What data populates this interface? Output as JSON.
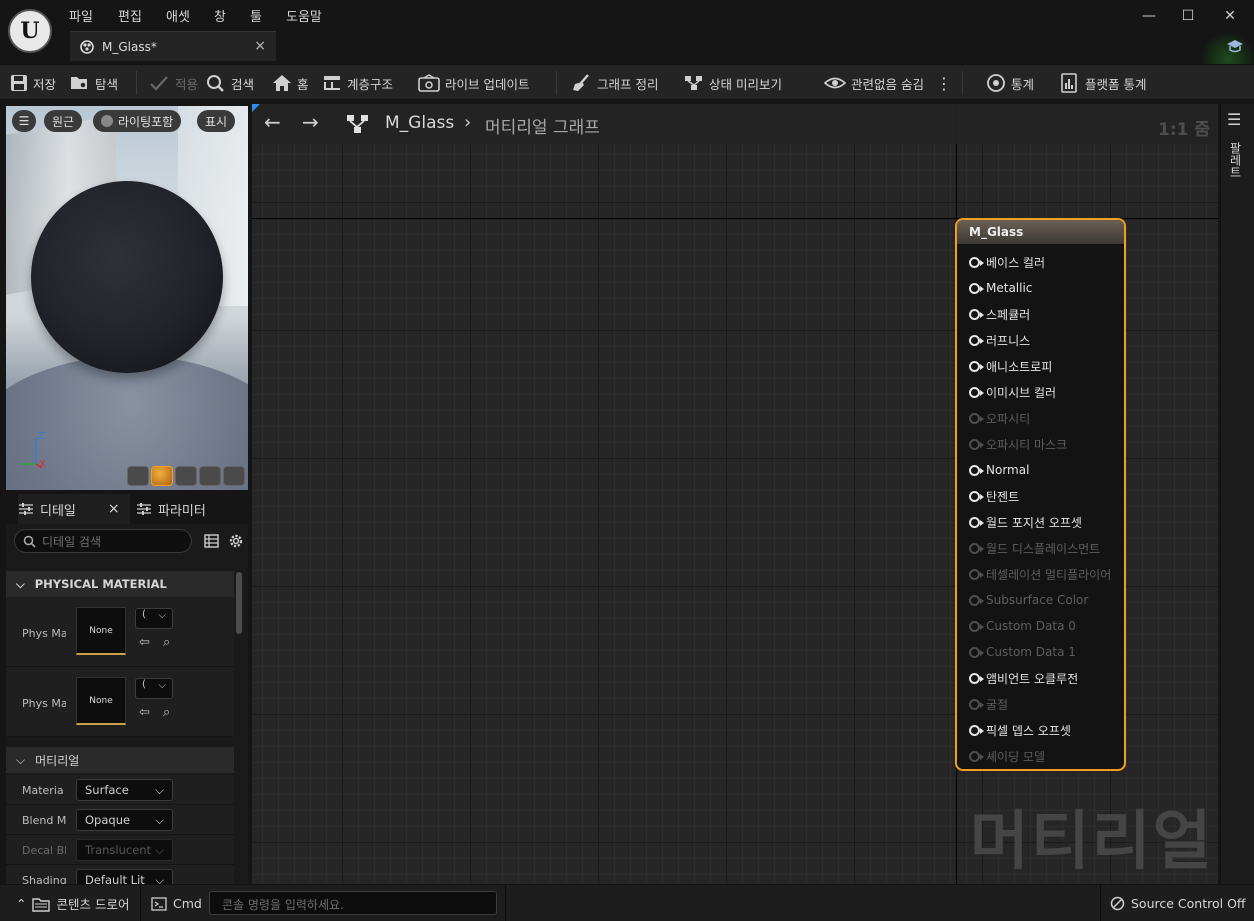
{
  "menu": [
    "파일",
    "편집",
    "애셋",
    "창",
    "툴",
    "도움말"
  ],
  "tab": {
    "title": "M_Glass*",
    "close": "×"
  },
  "window": {
    "minimize": "—",
    "maximize": "☐",
    "close": "✕"
  },
  "toolbar": {
    "save": "저장",
    "browse": "탐색",
    "apply": "적용",
    "search": "검색",
    "home": "홈",
    "hierarchy": "계층구조",
    "live_update": "라이브 업데이트",
    "clean_graph": "그래프 정리",
    "state_preview": "상태 미리보기",
    "hide_unrelated": "관련없음 숨김",
    "stats": "통계",
    "platform_stats": "플랫폼 통계"
  },
  "preview": {
    "perspective": "원근",
    "lighting": "라이팅포함",
    "show": "표시",
    "axis_z": "Z",
    "axis_x": "X"
  },
  "details": {
    "tab_details": "디테일",
    "tab_params": "파라미터",
    "close": "×",
    "search_placeholder": "디테일 검색",
    "section_physical": "PHYSICAL MATERIAL",
    "section_material": "머티리얼",
    "physical_rows": [
      {
        "label": "Phys Ma",
        "thumb": "None",
        "dd": "("
      },
      {
        "label": "Phys Ma",
        "thumb": "None",
        "dd": "("
      }
    ],
    "material_rows": [
      {
        "label": "Materia",
        "value": "Surface"
      },
      {
        "label": "Blend M",
        "value": "Opaque"
      },
      {
        "label": "Decal Bl",
        "value": "Translucent"
      },
      {
        "label": "Shading",
        "value": "Default Lit"
      }
    ]
  },
  "graph": {
    "crumb_asset": "M_Glass",
    "crumb_graph": "머티리얼 그래프",
    "zoom": "1:1 줌",
    "watermark": "머티리얼"
  },
  "node": {
    "title": "M_Glass",
    "pins": [
      {
        "label": "베이스 컬러",
        "enabled": true
      },
      {
        "label": "Metallic",
        "enabled": true
      },
      {
        "label": "스페큘러",
        "enabled": true
      },
      {
        "label": "러프니스",
        "enabled": true
      },
      {
        "label": "애니소트로피",
        "enabled": true
      },
      {
        "label": "이미시브 컬러",
        "enabled": true
      },
      {
        "label": "오파시티",
        "enabled": false
      },
      {
        "label": "오파시티 마스크",
        "enabled": false
      },
      {
        "label": "Normal",
        "enabled": true
      },
      {
        "label": "탄젠트",
        "enabled": true
      },
      {
        "label": "월드 포지션 오프셋",
        "enabled": true
      },
      {
        "label": "월드 디스플레이스먼트",
        "enabled": false
      },
      {
        "label": "테셀레이션 멀티플라이어",
        "enabled": false
      },
      {
        "label": "Subsurface Color",
        "enabled": false
      },
      {
        "label": "Custom Data 0",
        "enabled": false
      },
      {
        "label": "Custom Data 1",
        "enabled": false
      },
      {
        "label": "앰비언트 오클루전",
        "enabled": true
      },
      {
        "label": "굴절",
        "enabled": false
      },
      {
        "label": "픽셀 뎁스 오프셋",
        "enabled": true
      },
      {
        "label": "셰이딩 모델",
        "enabled": false
      }
    ]
  },
  "palette": {
    "label": "팔레트"
  },
  "status": {
    "content_drawer": "콘텐츠 드로어",
    "cmd": "Cmd",
    "cmd_placeholder": "콘솔 명령을 입력하세요.",
    "source_control": "Source Control Off"
  },
  "colors": {
    "accent": "#f0a020",
    "background": "#151515",
    "toolbar": "#242424"
  }
}
